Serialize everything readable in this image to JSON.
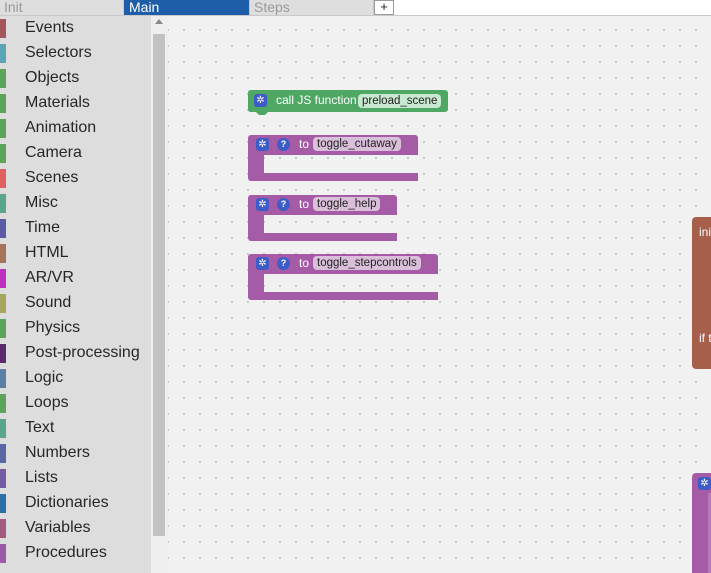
{
  "tabs": [
    {
      "label": "Init"
    },
    {
      "label": "Main"
    },
    {
      "label": "Steps"
    },
    {
      "label": "+"
    }
  ],
  "toolbox": {
    "categories": [
      {
        "label": "Events",
        "color": "#a6555c"
      },
      {
        "label": "Selectors",
        "color": "#5ba5b5"
      },
      {
        "label": "Objects",
        "color": "#5ba55b"
      },
      {
        "label": "Materials",
        "color": "#5ba55b"
      },
      {
        "label": "Animation",
        "color": "#5ba55b"
      },
      {
        "label": "Camera",
        "color": "#5ba55b"
      },
      {
        "label": "Scenes",
        "color": "#e06060"
      },
      {
        "label": "Misc",
        "color": "#5ba58c"
      },
      {
        "label": "Time",
        "color": "#5b5ba5"
      },
      {
        "label": "HTML",
        "color": "#a5745b"
      },
      {
        "label": "AR/VR",
        "color": "#c030c0"
      },
      {
        "label": "Sound",
        "color": "#a5a55b"
      },
      {
        "label": "Physics",
        "color": "#5ba55b"
      },
      {
        "label": "Post-processing",
        "color": "#5a2a6a"
      },
      {
        "label": "Logic",
        "color": "#5b80a5"
      },
      {
        "label": "Loops",
        "color": "#5ba55b"
      },
      {
        "label": "Text",
        "color": "#5ba58c"
      },
      {
        "label": "Numbers",
        "color": "#5b67a5"
      },
      {
        "label": "Lists",
        "color": "#745ba5"
      },
      {
        "label": "Dictionaries",
        "color": "#2a6fa8"
      },
      {
        "label": "Variables",
        "color": "#a55b80"
      },
      {
        "label": "Procedures",
        "color": "#995ba5"
      }
    ]
  },
  "workspace": {
    "call_block": {
      "label": "call JS function",
      "func_name": "preload_scene",
      "color": "#4fa764"
    },
    "procedures": [
      {
        "keyword": "to",
        "name": "toggle_cutaway"
      },
      {
        "keyword": "to",
        "name": "toggle_help"
      },
      {
        "keyword": "to",
        "name": "toggle_stepcontrols"
      }
    ],
    "offscreen_block": {
      "text_top": "ini",
      "text_mid": "if t",
      "color": "#a55f4b"
    },
    "offscreen_block2": {
      "color": "#a55ba6"
    }
  }
}
